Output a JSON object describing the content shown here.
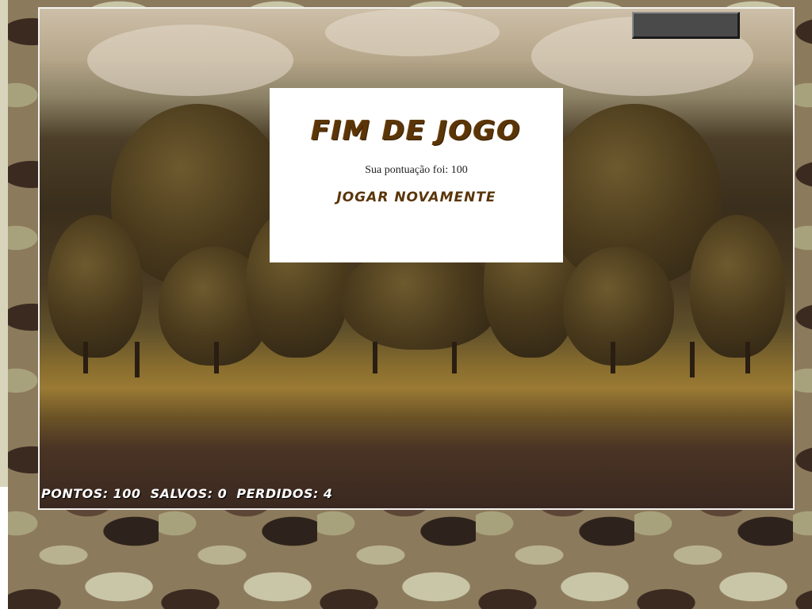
{
  "game_over": {
    "title": "FIM DE JOGO",
    "score_message": "Sua pontuação foi: 100",
    "play_again_label": "JOGAR NOVAMENTE"
  },
  "hud": {
    "points_label": "PONTOS:",
    "points_value": "100",
    "saved_label": "SALVOS:",
    "saved_value": "0",
    "lost_label": "PERDIDOS:",
    "lost_value": "4"
  },
  "colors": {
    "title_brown": "#5a3508",
    "hud_text": "#ffffff",
    "panel_bg": "#ffffff"
  }
}
